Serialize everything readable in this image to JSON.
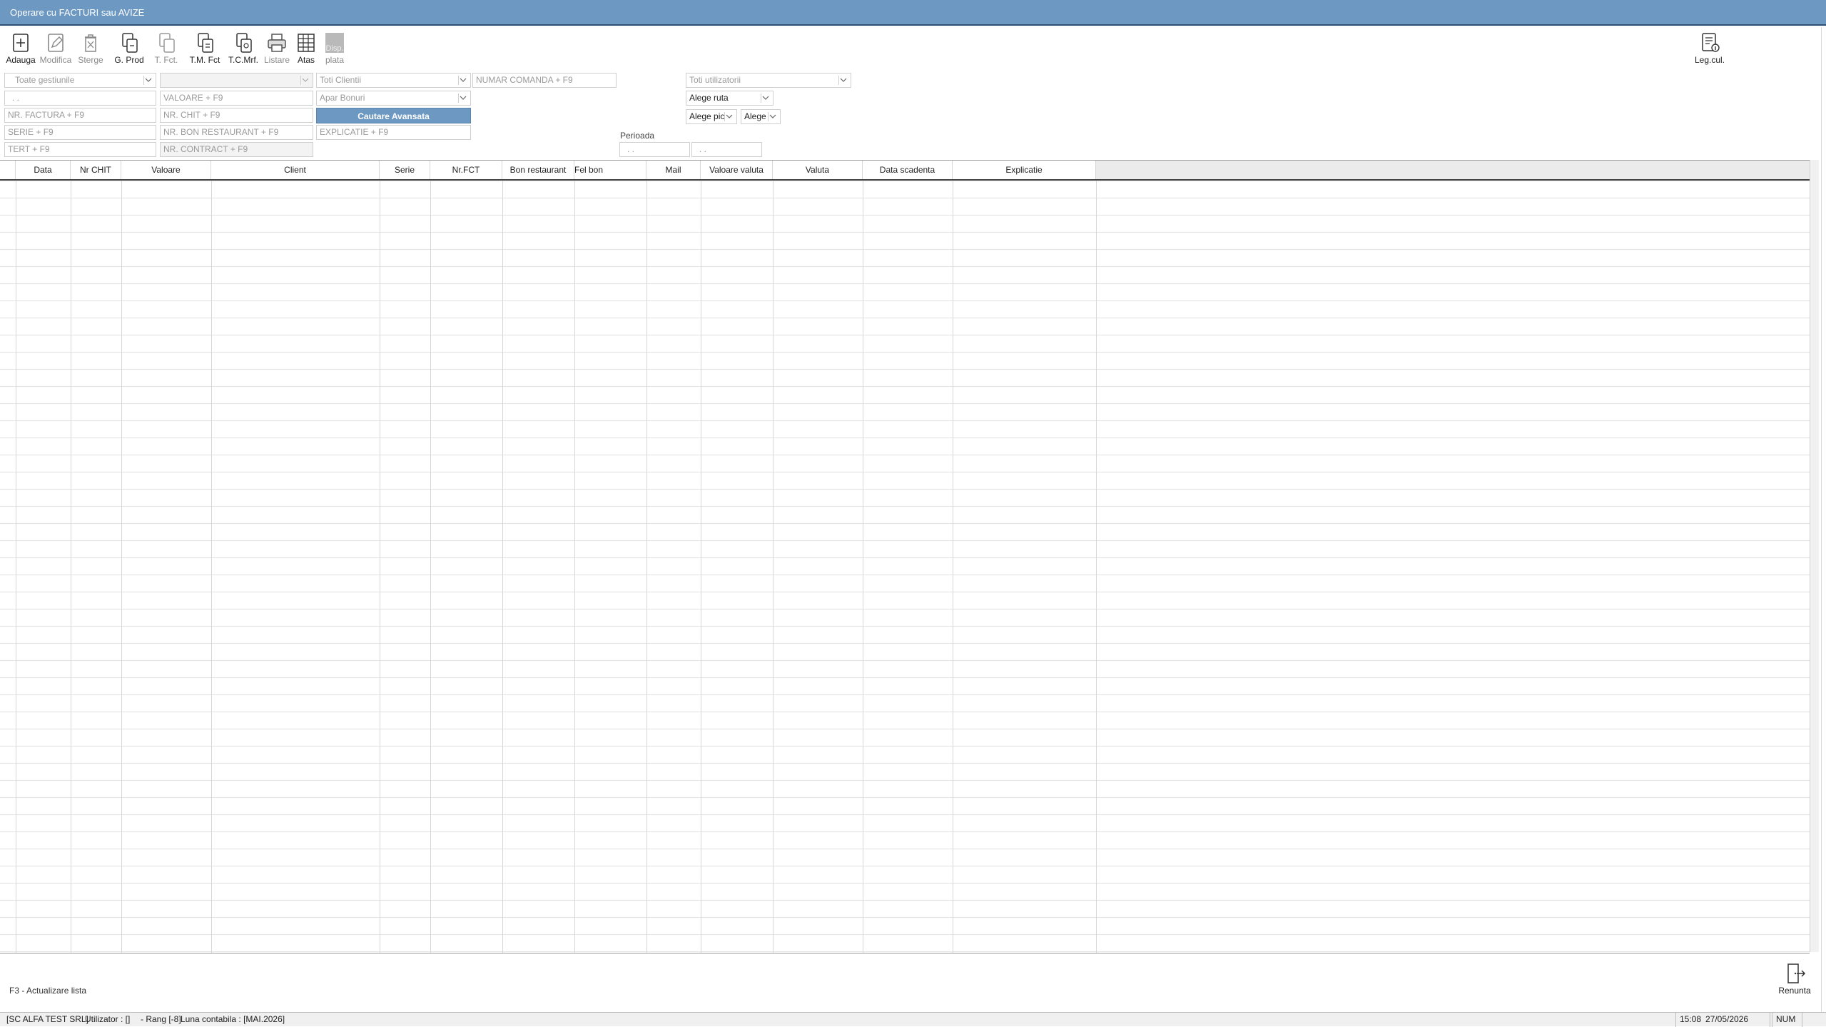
{
  "window": {
    "title": "Operare cu FACTURI sau AVIZE"
  },
  "toolbar": {
    "adauga": "Adauga",
    "modifica": "Modifica",
    "sterge": "Sterge",
    "g_prod": "G. Prod",
    "t_fct": "T. Fct.",
    "tm_fct": "T.M. Fct",
    "tc_mrf": "T.C.Mrf.",
    "listare": "Listare",
    "atas": "Atas",
    "disp_plata_1": "Disp.",
    "disp_plata_2": "plata",
    "leg_cul": "Leg.cul."
  },
  "filters": {
    "gestiuni": "Toate gestiunile",
    "blank_select": "",
    "clienti": "Toti Clientii",
    "numar_comanda": "NUMAR COMANDA + F9",
    "utilizatori": "Toti utilizatorii",
    "date_empty": ". .",
    "valoare": "VALOARE + F9",
    "apar_bonuri": "Apar Bonuri",
    "alege_ruta": "Alege ruta",
    "nr_factura": "NR. FACTURA + F9",
    "nr_chit": "NR. CHIT + F9",
    "cautare_avansata": "Cautare Avansata",
    "alege_pic": "Alege pic",
    "alege": "Alege",
    "serie": "SERIE + F9",
    "nr_bon_restaurant": "NR. BON RESTAURANT + F9",
    "explicatie": "EXPLICATIE + F9",
    "perioada_label": "Perioada",
    "perioada_start": ". .",
    "perioada_end": ". .",
    "tert": "TERT + F9",
    "nr_contract": "NR. CONTRACT + F9"
  },
  "table": {
    "columns": [
      "Data",
      "Nr CHIT",
      "Valoare",
      "Client",
      "Serie",
      "Nr.FCT",
      "Bon restaurant",
      "Fel bon",
      "Mail",
      "Valoare valuta",
      "Valuta",
      "Data scadenta",
      "Explicatie"
    ],
    "rows": []
  },
  "footer": {
    "hint": "F3 - Actualizare lista",
    "renunta": "Renunta"
  },
  "status": {
    "company": "[SC ALFA TEST SRL]",
    "user": "Utilizator : []",
    "rang": "- Rang [-8]",
    "luna": "Luna contabila : [MAI.2026]",
    "time": "15:08",
    "date": "27/05/2026",
    "num": "NUM"
  },
  "colors": {
    "titlebar": "#6c98c2",
    "accent_button": "#6c98c2"
  }
}
